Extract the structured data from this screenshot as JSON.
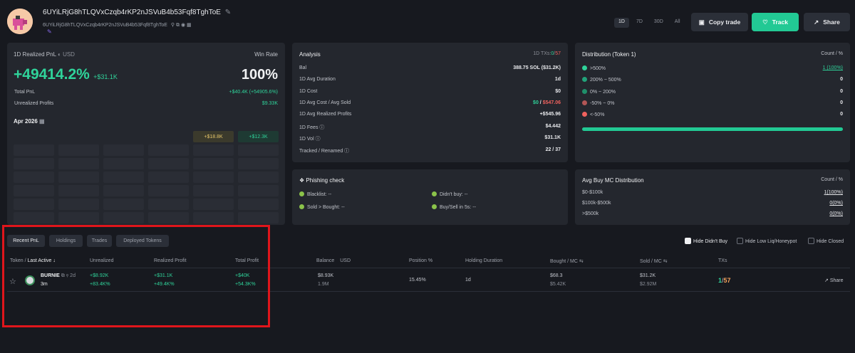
{
  "header": {
    "address": "6UYiLRjG8hTLQVxCzqb4rKP2nJSVuB4b53Fqf8TghToE",
    "address_short": "6UYiLRjG8hTLQVxCzqb4rKP2nJSVuB4b53Fqf8TghToE",
    "periods": [
      "1D",
      "7D",
      "30D",
      "All"
    ],
    "active_period": "1D",
    "copy_label": "Copy trade",
    "track_label": "Track",
    "share_label": "Share"
  },
  "pnl_card": {
    "title": "1D Realized PnL",
    "currency": "USD",
    "winrate_label": "Win Rate",
    "pnl_pct": "+49414.2%",
    "pnl_usd": "+$31.1K",
    "winrate": "100%",
    "total_label": "Total PnL",
    "total_value": "+$40.4K (+54905.6%)",
    "unrealized_label": "Unrealized Profits",
    "unrealized_value": "$9.33K",
    "month": "Apr 2026",
    "cal_a": "+$18.8K",
    "cal_b": "+$12.3K"
  },
  "analysis": {
    "title": "Analysis",
    "txs_label": "1D TXs:",
    "txs_buy": "0",
    "txs_sell": "57",
    "rows": [
      {
        "label": "Bal",
        "value": "388.75 SOL ($31.2K)"
      },
      {
        "label": "1D Avg Duration",
        "value": "1d"
      },
      {
        "label": "1D Cost",
        "value": "$0"
      },
      {
        "label": "1D Avg Cost / Avg Sold",
        "value_a": "$0",
        "value_b": "$547.06"
      },
      {
        "label": "1D Avg Realized Profits",
        "value": "+$545.96"
      },
      {
        "label": "1D Fees",
        "value": "$4.442"
      },
      {
        "label": "1D Vol",
        "value": "$31.1K"
      },
      {
        "label": "Tracked / Renamed",
        "value": "22 / 37"
      }
    ]
  },
  "distribution": {
    "title": "Distribution (Token 1)",
    "col": "Count / %",
    "rows": [
      {
        "label": ">500%",
        "value": "1 (100%)",
        "color": "#2fd39a"
      },
      {
        "label": "200% ~ 500%",
        "value": "0",
        "color": "#22a37a"
      },
      {
        "label": "0% ~ 200%",
        "value": "0",
        "color": "#1f8f6a"
      },
      {
        "label": "-50% ~ 0%",
        "value": "0",
        "color": "#b25656"
      },
      {
        "label": "<-50%",
        "value": "0",
        "color": "#f0625e"
      }
    ],
    "bar_fill": 1.0
  },
  "phishing": {
    "title": "Phishing check",
    "items": [
      "Blacklist: --",
      "Didn't buy: --",
      "Sold > Bought: --",
      "Buy/Sell in 5s: --"
    ]
  },
  "avg_mc": {
    "title": "Avg Buy MC Distribution",
    "col": "Count / %",
    "rows": [
      {
        "label": "$0-$100k",
        "value": "1(100%)"
      },
      {
        "label": "$100k-$500k",
        "value": "0(0%)"
      },
      {
        "label": ">$500k",
        "value": "0(0%)"
      }
    ]
  },
  "tabs": [
    "Recent PnL",
    "Holdings",
    "Trades",
    "Deployed Tokens"
  ],
  "filters": [
    "Hide Didn't Buy",
    "Hide Low Liq/Honeypot",
    "Hide Closed"
  ],
  "table": {
    "headers": {
      "token": "Token",
      "last_active": "Last Active",
      "unrealized": "Unrealized",
      "realized": "Realized Profit",
      "total": "Total Profit",
      "balance": "Balance",
      "balance_unit": "USD",
      "position": "Position %",
      "holding": "Holding Duration",
      "bought": "Bought",
      "sold": "Sold",
      "mc": "MC",
      "txs": "TXs"
    },
    "row": {
      "token": "BURNIE",
      "age": "2d",
      "last_active": "3m",
      "unreal_usd": "+$8.92K",
      "unreal_pct": "+83.4K%",
      "real_usd": "+$31.1K",
      "real_pct": "+49.4K%",
      "total_usd": "+$40K",
      "total_pct": "+54.3K%",
      "balance_usd": "$8.93K",
      "balance_amt": "1.9M",
      "position": "15.45%",
      "holding": "1d",
      "bought_usd": "$68.3",
      "bought_mc": "$5.42K",
      "sold_usd": "$31.2K",
      "sold_mc": "$2.92M",
      "txs_buy": "1",
      "txs_sell": "57",
      "share": "Share"
    }
  }
}
